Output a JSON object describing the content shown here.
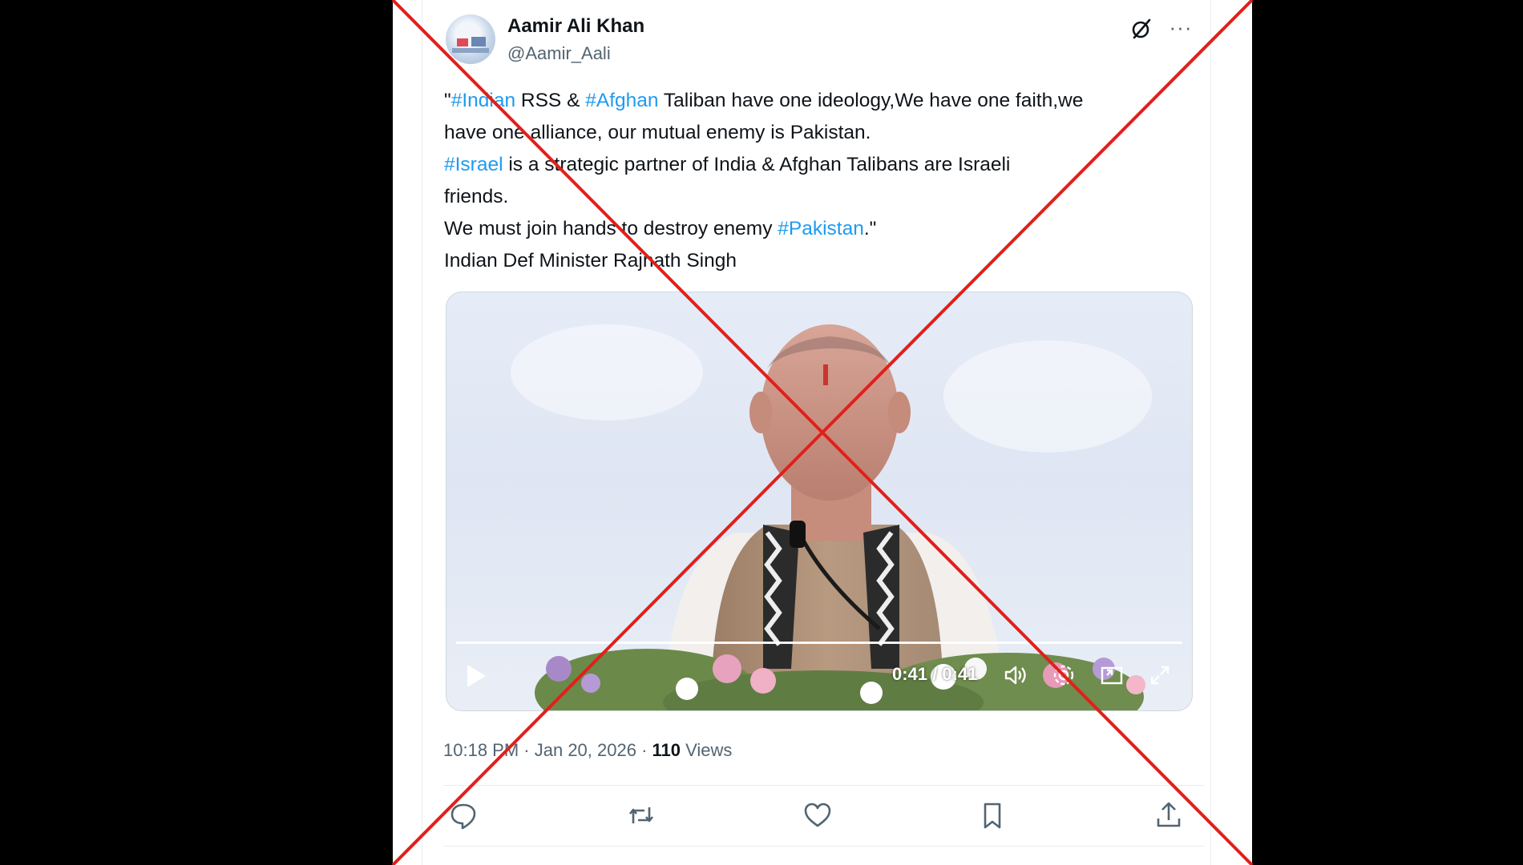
{
  "author": {
    "display_name": "Aamir Ali Khan",
    "handle": "@Aamir_Aali"
  },
  "tweet": {
    "lines": [
      [
        {
          "t": "\"",
          "hash": false
        },
        {
          "t": "#Indian",
          "hash": true
        },
        {
          "t": " RSS & ",
          "hash": false
        },
        {
          "t": "#Afghan",
          "hash": true
        },
        {
          "t": " Taliban have one ideology,We have one faith,we",
          "hash": false
        }
      ],
      [
        {
          "t": "have one alliance, our mutual enemy is Pakistan.",
          "hash": false
        }
      ],
      [
        {
          "t": "#Israel",
          "hash": true
        },
        {
          "t": " is a strategic partner of India & Afghan Talibans are Israeli",
          "hash": false
        }
      ],
      [
        {
          "t": "friends.",
          "hash": false
        }
      ],
      [
        {
          "t": "We must join hands to destroy  enemy ",
          "hash": false
        },
        {
          "t": "#Pakistan",
          "hash": true
        },
        {
          "t": ".\"",
          "hash": false
        }
      ],
      [
        {
          "t": "Indian Def Minister Rajnath Singh",
          "hash": false
        }
      ]
    ]
  },
  "video": {
    "time_display": "0:41 / 0:41",
    "progress": 1.0
  },
  "meta": {
    "time": "10:18 PM",
    "sep1": " · ",
    "date": "Jan 20, 2026",
    "sep2": " · ",
    "views_count": "110",
    "views_label": " Views"
  },
  "icons": [
    "grok-icon",
    "more-icon",
    "play-icon",
    "volume-icon",
    "settings-icon",
    "pip-icon",
    "fullscreen-icon",
    "reply-icon",
    "retweet-icon",
    "like-icon",
    "bookmark-icon",
    "share-icon"
  ],
  "colors": {
    "hashtag": "#1d9bf0",
    "text": "#0f1419",
    "secondary": "#536471",
    "cross": "#e0201b"
  }
}
